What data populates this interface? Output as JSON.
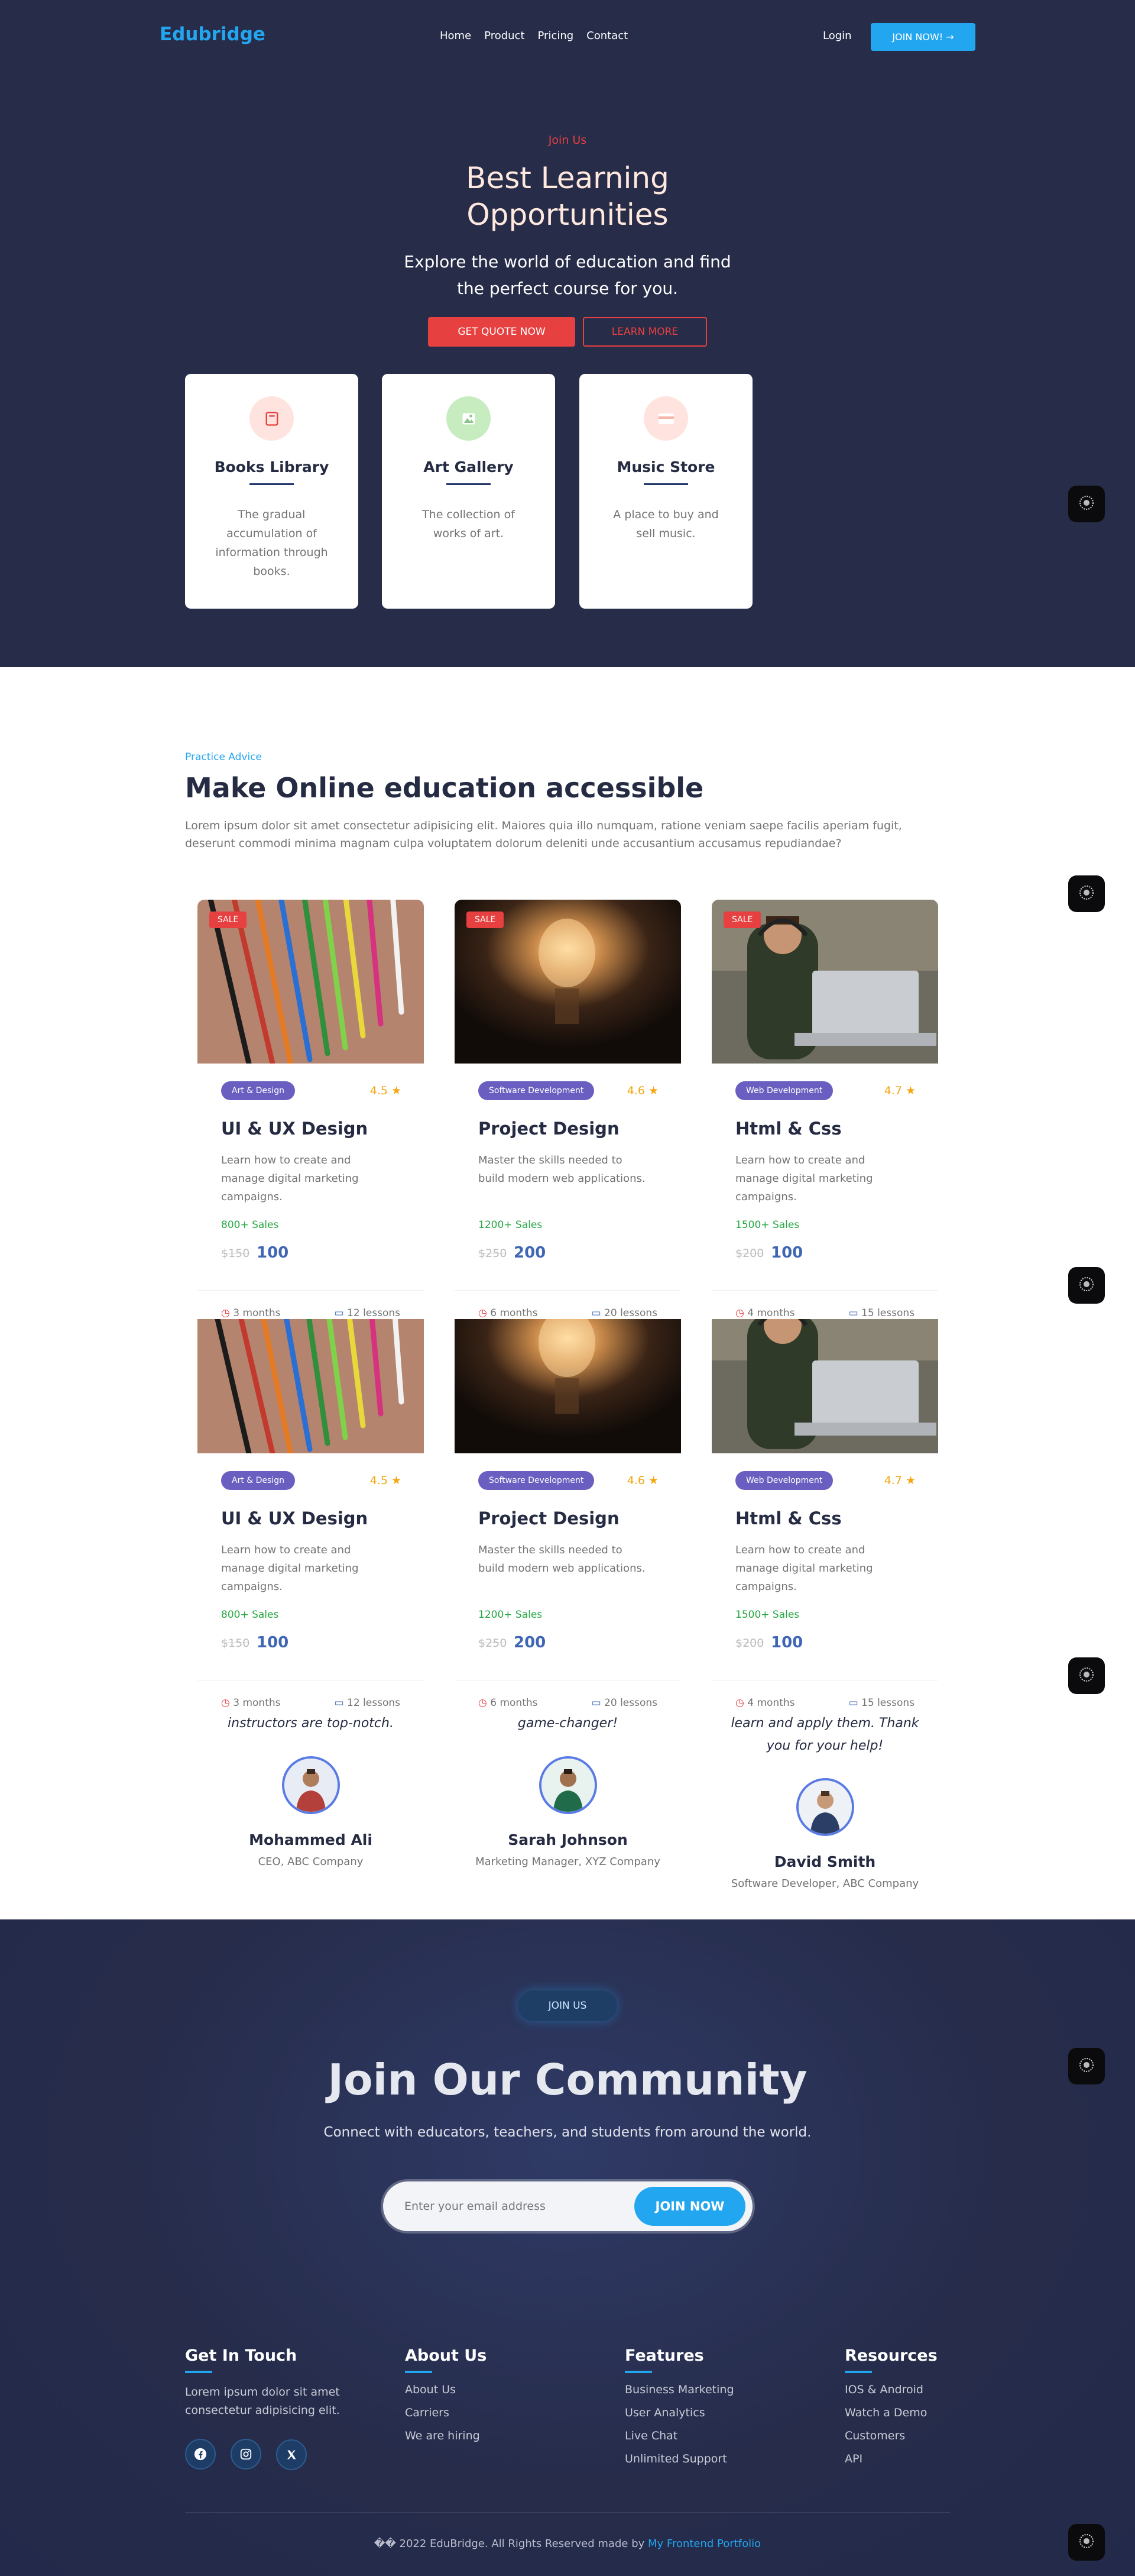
{
  "nav": {
    "logo": "Edubridge",
    "links": [
      "Home",
      "Product",
      "Pricing",
      "Contact"
    ],
    "login": "Login",
    "join": "JOIN NOW! →"
  },
  "hero": {
    "kicker": "Join Us",
    "title_line1": "Best Learning",
    "title_line2": "Opportunities",
    "sub_line1": "Explore the world of education and find",
    "sub_line2": "the perfect course for you.",
    "btn_quote": "GET QUOTE NOW",
    "btn_learn": "LEARN MORE"
  },
  "features": [
    {
      "title": "Books Library",
      "desc": "The gradual accumulation of information through books.",
      "icon": "book-icon",
      "color": "#ffe3de"
    },
    {
      "title": "Art Gallery",
      "desc": "The collection of works of art.",
      "icon": "image-icon",
      "color": "#c7ecc0"
    },
    {
      "title": "Music Store",
      "desc": "A place to buy and sell music.",
      "icon": "card-icon",
      "color": "#ffe3de"
    }
  ],
  "courses_section": {
    "kicker": "Practice Advice",
    "title": "Make Online education accessible",
    "desc": "Lorem ipsum dolor sit amet consectetur adipisicing elit. Maiores quia illo numquam, ratione veniam saepe facilis aperiam fugit, deserunt commodi minima magnam culpa voluptatem dolorum deleniti unde accusantium accusamus repudiandae?"
  },
  "courses": [
    {
      "sale": "SALE",
      "category": "Art & Design",
      "rating": "4.5",
      "title": "UI & UX Design",
      "desc": "Learn how to create and manage digital marketing campaigns.",
      "sales": "800+ Sales",
      "old_price": "$150",
      "price": "100",
      "duration": "3 months",
      "lessons": "12 lessons"
    },
    {
      "sale": "SALE",
      "category": "Software Development",
      "rating": "4.6",
      "title": "Project Design",
      "desc": "Master the skills needed to build modern web applications.",
      "sales": "1200+ Sales",
      "old_price": "$250",
      "price": "200",
      "duration": "6 months",
      "lessons": "20 lessons"
    },
    {
      "sale": "SALE",
      "category": "Web Development",
      "rating": "4.7",
      "title": "Html & Css",
      "desc": "Learn how to create and manage digital marketing campaigns.",
      "sales": "1500+ Sales",
      "old_price": "$200",
      "price": "100",
      "duration": "4 months",
      "lessons": "15 lessons"
    }
  ],
  "testimonials": [
    {
      "quote_tail": "instructors are top-notch.",
      "name": "Mohammed Ali",
      "role": "CEO, ABC Company"
    },
    {
      "quote_tail": "game-changer!",
      "name": "Sarah Johnson",
      "role": "Marketing Manager, XYZ Company"
    },
    {
      "quote_line1": "learn and apply them. Thank",
      "quote_line2": "you for your help!",
      "name": "David Smith",
      "role": "Software Developer, ABC Company"
    }
  ],
  "community": {
    "pill": "JOIN US",
    "title": "Join Our Community",
    "sub": "Connect with educators, teachers, and students from around the world.",
    "placeholder": "Enter your email address",
    "button": "JOIN NOW"
  },
  "footer": {
    "touch": {
      "title": "Get In Touch",
      "text": "Lorem ipsum dolor sit amet consectetur adipisicing elit."
    },
    "about": {
      "title": "About Us",
      "items": [
        "About Us",
        "Carriers",
        "We are hiring"
      ]
    },
    "features": {
      "title": "Features",
      "items": [
        "Business Marketing",
        "User Analytics",
        "Live Chat",
        "Unlimited Support"
      ]
    },
    "resources": {
      "title": "Resources",
      "items": [
        "IOS & Android",
        "Watch a Demo",
        "Customers",
        "API"
      ]
    },
    "copyright": "�� 2022 EduBridge. All Rights Reserved made by ",
    "copyright_link": "My Frontend Portfolio"
  }
}
